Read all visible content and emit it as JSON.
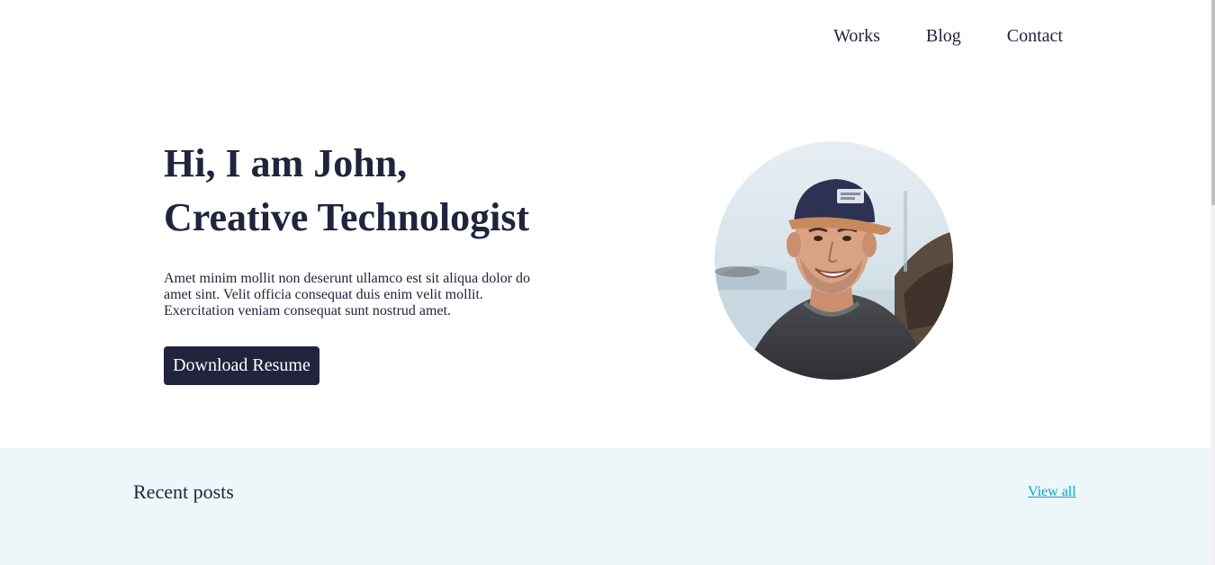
{
  "nav": {
    "items": [
      {
        "label": "Works"
      },
      {
        "label": "Blog"
      },
      {
        "label": "Contact"
      }
    ]
  },
  "hero": {
    "title_line1": "Hi, I am John,",
    "title_line2": "Creative Technologist",
    "description": "Amet minim mollit non deserunt ullamco est sit aliqua dolor do amet sint. Velit officia consequat duis enim velit mollit. Exercitation veniam consequat sunt nostrud amet.",
    "button_label": "Download Resume"
  },
  "recent_posts": {
    "title": "Recent posts",
    "view_all_label": "View all"
  },
  "colors": {
    "text_primary": "#21243d",
    "button_bg": "#21243d",
    "section_bg": "#edf7fa",
    "link": "#00a8cc"
  },
  "icons": {
    "avatar": "profile-photo-man-cap"
  }
}
